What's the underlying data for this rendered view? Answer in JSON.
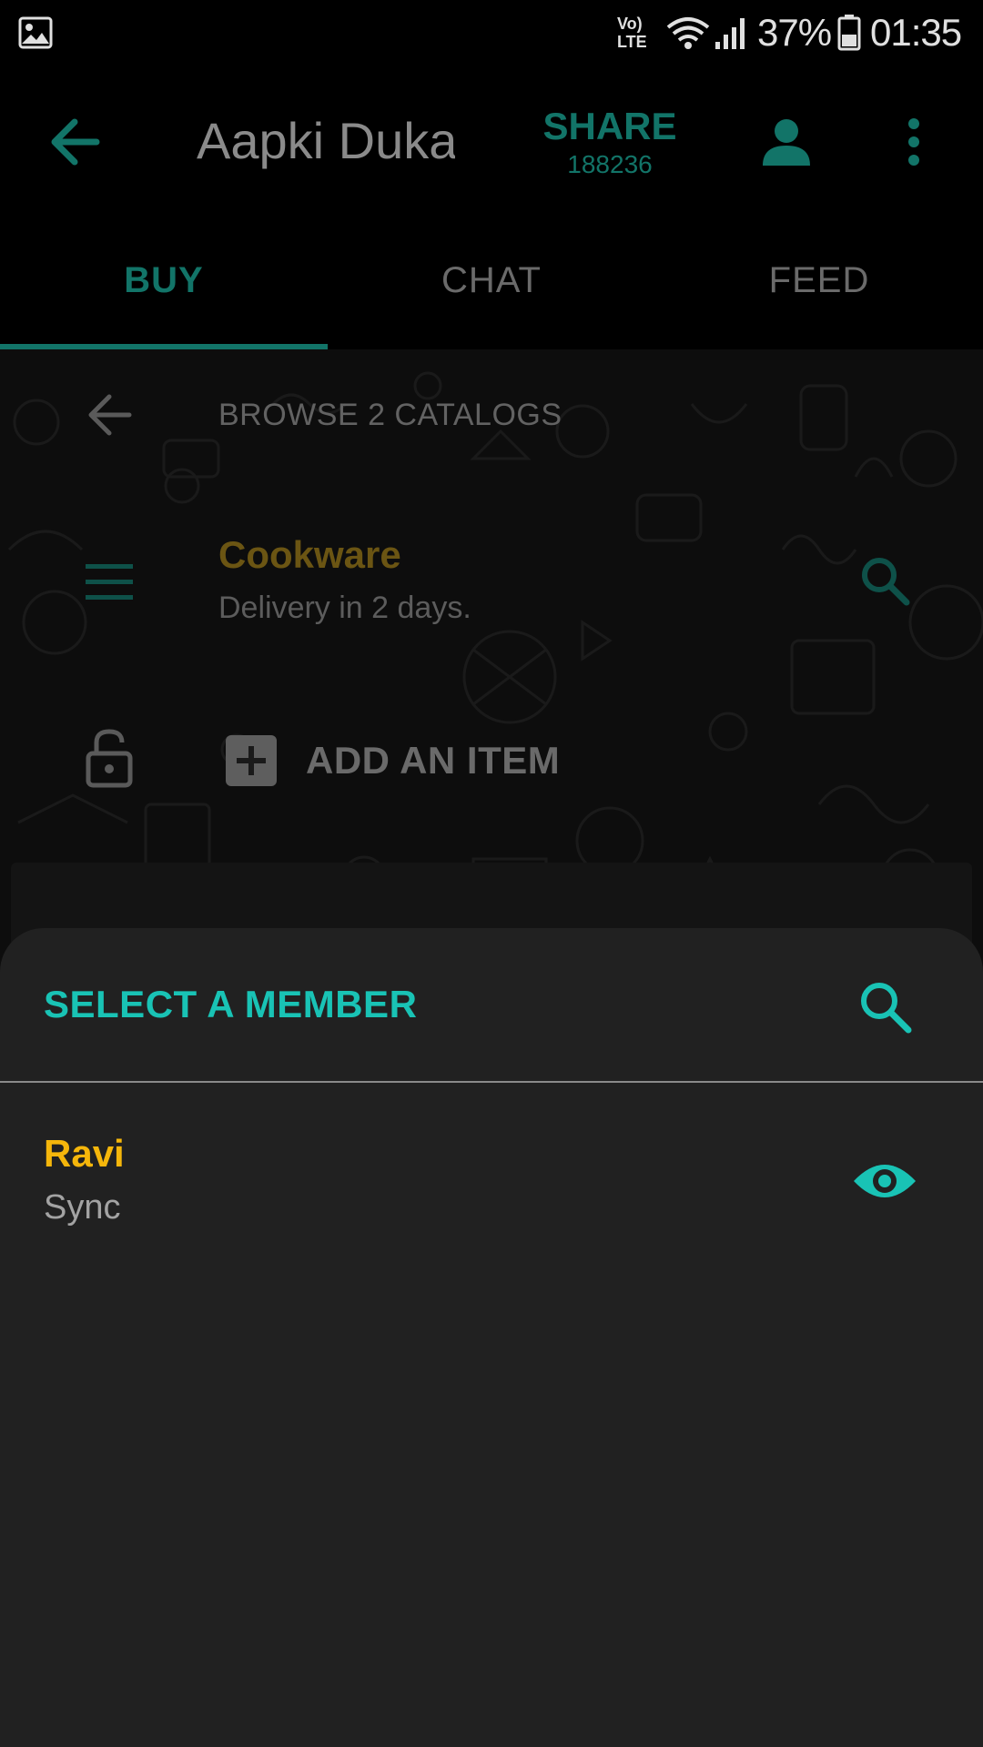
{
  "status_bar": {
    "battery_percent": "37%",
    "time": "01:35",
    "network_label": "Vo) LTE",
    "icons": [
      "gallery-icon",
      "volte-icon",
      "wifi-icon",
      "signal-icon",
      "battery-icon"
    ]
  },
  "app_bar": {
    "title": "Aapki Duka",
    "share_label": "SHARE",
    "share_code": "188236",
    "icons": [
      "back-arrow-icon",
      "person-icon",
      "more-vert-icon"
    ]
  },
  "tabs": [
    {
      "label": "BUY",
      "active": true
    },
    {
      "label": "CHAT",
      "active": false
    },
    {
      "label": "FEED",
      "active": false
    }
  ],
  "content": {
    "browse_label": "BROWSE 2 CATALOGS",
    "catalog": {
      "name": "Cookware",
      "subtitle": "Delivery in 2 days."
    },
    "add_item_label": "ADD AN ITEM"
  },
  "sheet": {
    "title": "SELECT A MEMBER",
    "members": [
      {
        "name": "Ravi",
        "status": "Sync"
      }
    ]
  },
  "colors": {
    "accent_teal": "#127468",
    "sheet_accent": "#19c3b5",
    "member_name": "#f5b60b",
    "sheet_bg": "#212121"
  }
}
